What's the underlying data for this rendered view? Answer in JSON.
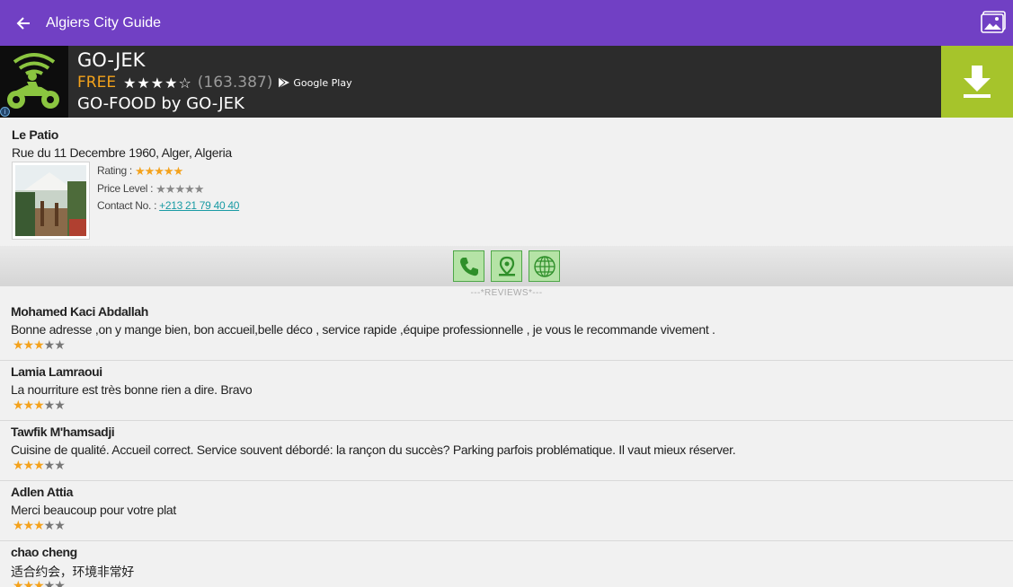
{
  "appbar": {
    "title": "Algiers City Guide",
    "back_icon": "arrow-back-icon",
    "gallery_icon": "image-gallery-icon"
  },
  "ad": {
    "app_name": "GO-JEK",
    "price": "FREE",
    "stars": "★★★★☆",
    "rating_count": "(163.387)",
    "store_label": "Google Play",
    "subtitle": "GO-FOOD by GO-JEK",
    "info_icon": "ad-info-icon",
    "download_icon": "download-icon",
    "accent": "#a6c42b"
  },
  "place": {
    "name": "Le Patio",
    "address": "Rue du 11 Decembre 1960, Alger, Algeria",
    "rating_label": "Rating :",
    "rating_stars": "★★★★★",
    "rating_value": 4.5,
    "price_label": "Price Level :",
    "price_stars": "★★★★★",
    "contact_label": "Contact No. :",
    "contact_number": "+213 21 79 40 40"
  },
  "actions": {
    "call_icon": "phone-icon",
    "map_icon": "map-pin-icon",
    "web_icon": "globe-icon"
  },
  "reviews_header": "---*REVIEWS*---",
  "reviews": [
    {
      "name": "Mohamed Kaci Abdallah",
      "text": "Bonne adresse ,on y mange bien, bon accueil,belle déco ,  service rapide ,équipe professionnelle , je vous le recommande vivement .",
      "stars_on": "★★★",
      "stars_off": "★★"
    },
    {
      "name": "Lamia Lamraoui",
      "text": "La nourriture est très bonne rien a dire. Bravo",
      "stars_on": "★★★",
      "stars_off": "★★"
    },
    {
      "name": "Tawfik M'hamsadji",
      "text": "Cuisine de qualité. Accueil correct. Service souvent débordé: la rançon du succès? Parking parfois problématique. Il vaut mieux réserver.",
      "stars_on": "★★★",
      "stars_off": "★★"
    },
    {
      "name": "Adlen Attia",
      "text": "Merci beaucoup pour votre plat",
      "stars_on": "★★★",
      "stars_off": "★★"
    },
    {
      "name": "chao cheng",
      "text": "适合约会，环境非常好",
      "stars_on": "★★★",
      "stars_off": "★★"
    }
  ]
}
